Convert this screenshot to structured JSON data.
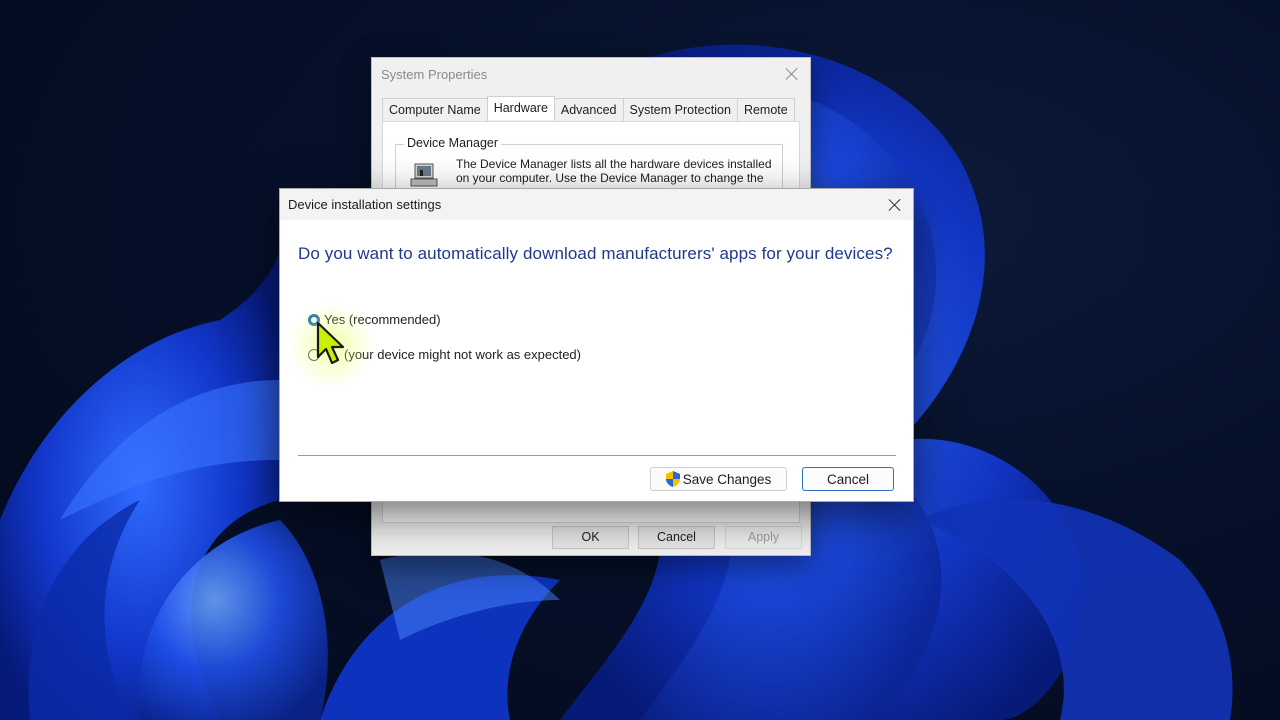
{
  "system_properties": {
    "title": "System Properties",
    "tabs": [
      "Computer Name",
      "Hardware",
      "Advanced",
      "System Protection",
      "Remote"
    ],
    "active_tab": "Hardware",
    "device_manager": {
      "group_label": "Device Manager",
      "description": "The Device Manager lists all the hardware devices installed on your computer. Use the Device Manager to change the"
    },
    "buttons": {
      "ok": "OK",
      "cancel": "Cancel",
      "apply": "Apply"
    }
  },
  "device_installation": {
    "title": "Device installation settings",
    "question": "Do you want to automatically download manufacturers' apps for your devices?",
    "options": [
      {
        "label": "Yes (recommended)",
        "selected": true
      },
      {
        "label": "(your device might not work as expected)",
        "selected": false
      }
    ],
    "buttons": {
      "save": "Save Changes",
      "cancel": "Cancel"
    }
  },
  "colors": {
    "question_text": "#1e3a8a",
    "radio_selected": "#1f6fb2",
    "primary_button_border": "#2d6fc4",
    "cursor_fill": "#c8f000"
  }
}
